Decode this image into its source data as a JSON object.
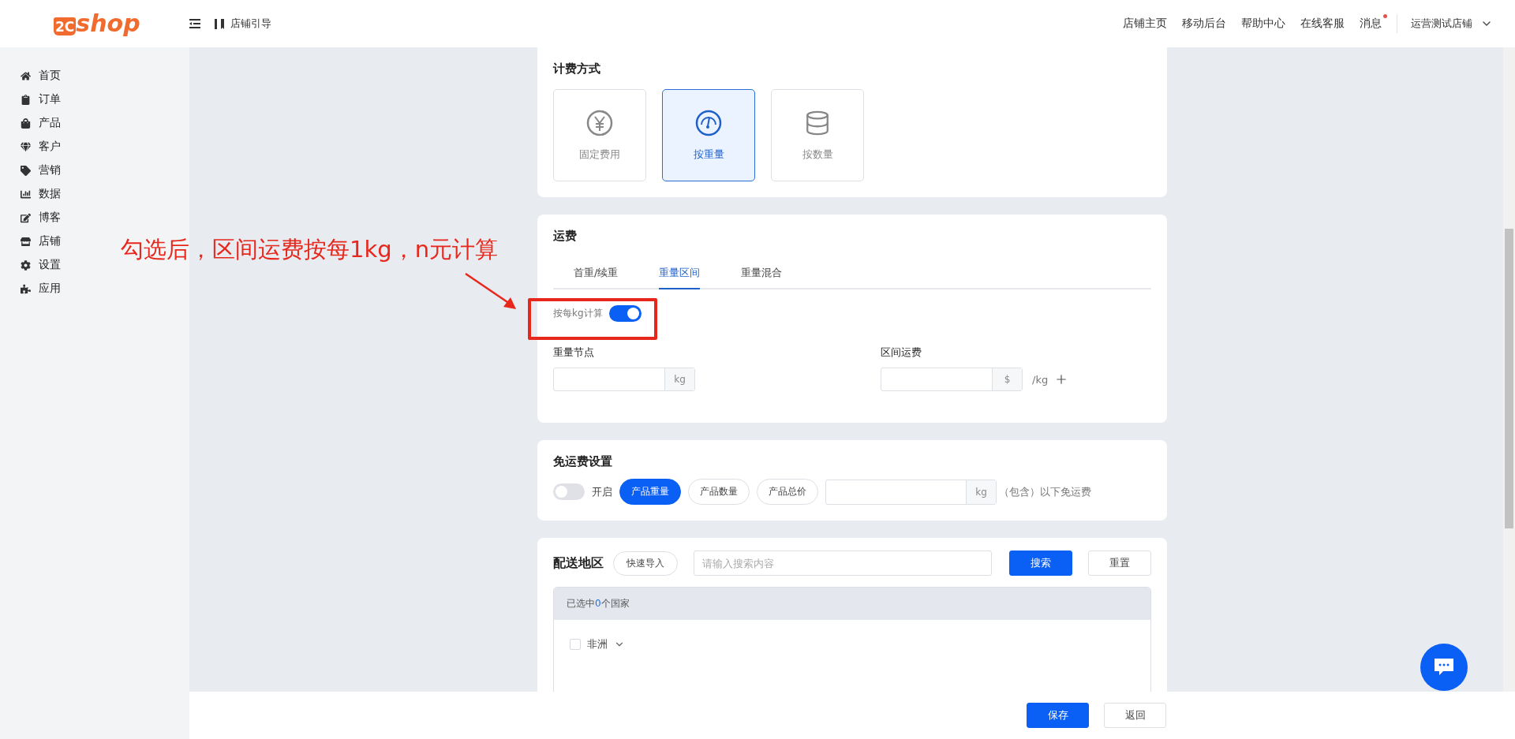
{
  "header": {
    "logo": {
      "mark": "2C",
      "text": "shop"
    },
    "guide": "店铺引导",
    "links": [
      "店铺主页",
      "移动后台",
      "帮助中心",
      "在线客服"
    ],
    "messages": {
      "label": "消息",
      "unread": true
    },
    "store": "运营测试店铺"
  },
  "sidebar": {
    "items": [
      {
        "label": "首页"
      },
      {
        "label": "订单"
      },
      {
        "label": "产品"
      },
      {
        "label": "客户"
      },
      {
        "label": "营销"
      },
      {
        "label": "数据"
      },
      {
        "label": "博客"
      },
      {
        "label": "店铺"
      },
      {
        "label": "设置"
      },
      {
        "label": "应用"
      }
    ]
  },
  "billing": {
    "title": "计费方式",
    "options": [
      {
        "label": "固定费用",
        "selected": false
      },
      {
        "label": "按重量",
        "selected": true
      },
      {
        "label": "按数量",
        "selected": false
      }
    ]
  },
  "shipping": {
    "title": "运费",
    "tabs": [
      {
        "label": "首重/续重",
        "selected": false
      },
      {
        "label": "重量区间",
        "selected": true
      },
      {
        "label": "重量混合",
        "selected": false
      }
    ],
    "per_kg": {
      "label": "按每kg计算",
      "on": true
    },
    "weight_node": {
      "label": "重量节点",
      "unit": "kg"
    },
    "range_fee": {
      "label": "区间运费",
      "unit": "$",
      "suffix": "/kg"
    }
  },
  "free_shipping": {
    "title": "免运费设置",
    "toggle": {
      "label": "开启",
      "on": false
    },
    "criteria": [
      {
        "label": "产品重量",
        "selected": true
      },
      {
        "label": "产品数量",
        "selected": false
      },
      {
        "label": "产品总价",
        "selected": false
      }
    ],
    "unit": "kg",
    "note": "（包含）以下免运费"
  },
  "delivery": {
    "title": "配送地区",
    "import": "快速导入",
    "search": {
      "placeholder": "请输入搜索内容"
    },
    "search_button": "搜索",
    "reset_button": "重置",
    "summary": {
      "prefix": "已选中",
      "count": "0",
      "suffix": "个国家"
    },
    "regions": [
      {
        "label": "非洲",
        "checked": false,
        "expanded": false
      }
    ]
  },
  "footer": {
    "buttons": [
      "保存",
      "返回"
    ]
  },
  "annotation": {
    "text": "勾选后，区间运费按每1kg，n元计算"
  }
}
